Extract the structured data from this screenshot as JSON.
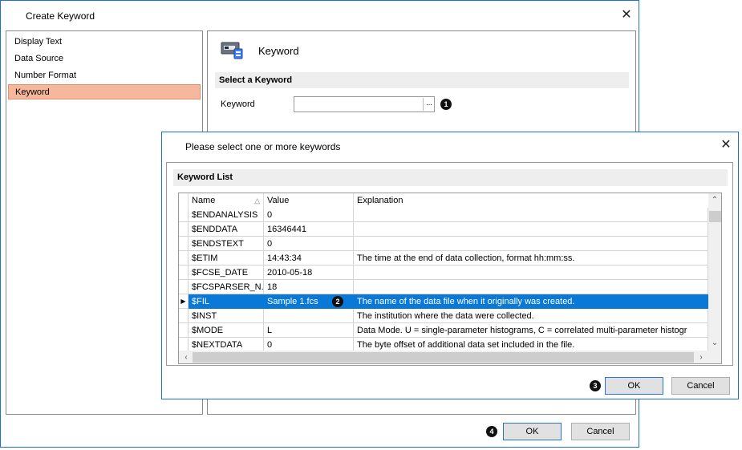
{
  "outer": {
    "title": "Create Keyword",
    "left_items": [
      "Display Text",
      "Data Source",
      "Number Format",
      "Keyword"
    ],
    "selected_index": 3,
    "panel_title": "Keyword",
    "section_header": "Select a Keyword",
    "keyword_label": "Keyword",
    "keyword_value": "",
    "browse_label": "...",
    "ok_label": "OK",
    "cancel_label": "Cancel"
  },
  "markers": {
    "m1": "1",
    "m2": "2",
    "m3": "3",
    "m4": "4"
  },
  "inner": {
    "title": "Please select one or more keywords",
    "list_header": "Keyword List",
    "columns": [
      "Name",
      "Value",
      "Explanation"
    ],
    "rows": [
      {
        "name": "$ENDANALYSIS",
        "value": "0",
        "explanation": ""
      },
      {
        "name": "$ENDDATA",
        "value": "16346441",
        "explanation": ""
      },
      {
        "name": "$ENDSTEXT",
        "value": "0",
        "explanation": ""
      },
      {
        "name": "$ETIM",
        "value": "14:43:34",
        "explanation": "The time at the end of data collection, format hh:mm:ss."
      },
      {
        "name": "$FCSE_DATE",
        "value": "2010-05-18",
        "explanation": ""
      },
      {
        "name": "$FCSPARSER_N...",
        "value": "18",
        "explanation": ""
      },
      {
        "name": "$FIL",
        "value": "Sample 1.fcs",
        "explanation": "The name of the data file when it originally was created."
      },
      {
        "name": "$INST",
        "value": "",
        "explanation": "The institution where the data were collected."
      },
      {
        "name": "$MODE",
        "value": "L",
        "explanation": "Data Mode.  U = single-parameter histograms, C = correlated multi-parameter histogr"
      },
      {
        "name": "$NEXTDATA",
        "value": "0",
        "explanation": "The byte offset of additional data set included in the file."
      }
    ],
    "selected_row": 6,
    "ok_label": "OK",
    "cancel_label": "Cancel"
  },
  "colors": {
    "selection": "#0a78d7",
    "left_selected": "#f6b89d",
    "window_border": "#1e6fd6"
  }
}
